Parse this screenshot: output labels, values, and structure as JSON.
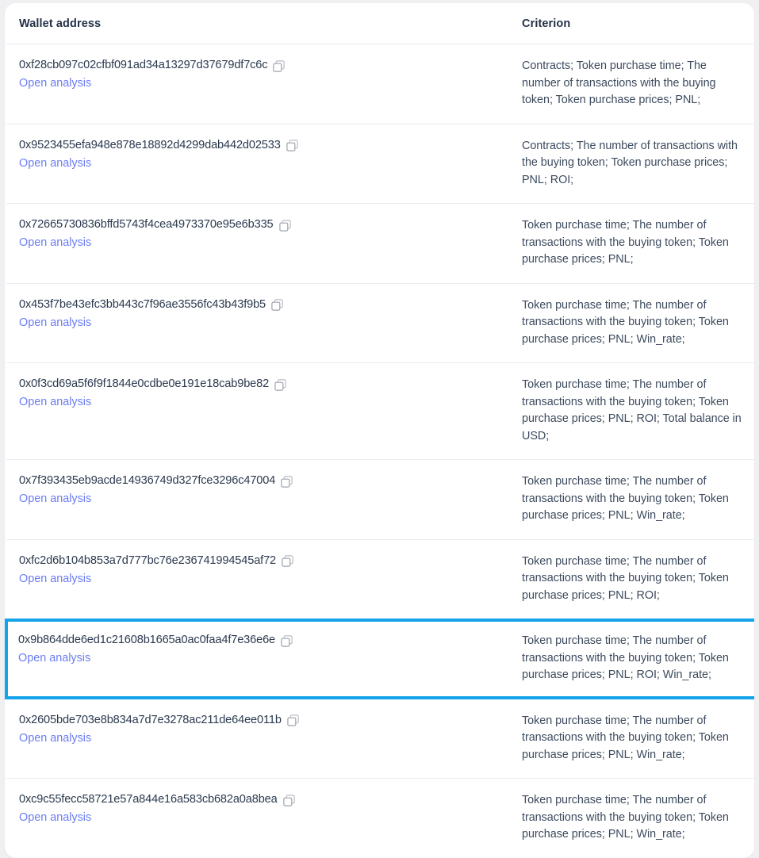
{
  "table": {
    "columns": [
      {
        "key": "wallet",
        "label": "Wallet address"
      },
      {
        "key": "criterion",
        "label": "Criterion"
      }
    ],
    "link_label": "Open analysis",
    "copy_icon": "copy-icon",
    "highlight_color": "#13a3e8",
    "link_color": "#6b7df3",
    "rows": [
      {
        "address": "0xf28cb097c02cfbf091ad34a13297d37679df7c6c",
        "link": "Open analysis",
        "criterion": "Contracts; Token purchase time; The number of transactions with the buying token; Token purchase prices; PNL;",
        "highlighted": false
      },
      {
        "address": "0x9523455efa948e878e18892d4299dab442d02533",
        "link": "Open analysis",
        "criterion": "Contracts; The number of transactions with the buying token; Token purchase prices; PNL; ROI;",
        "highlighted": false
      },
      {
        "address": "0x72665730836bffd5743f4cea4973370e95e6b335",
        "link": "Open analysis",
        "criterion": "Token purchase time; The number of transactions with the buying token; Token purchase prices; PNL;",
        "highlighted": false
      },
      {
        "address": "0x453f7be43efc3bb443c7f96ae3556fc43b43f9b5",
        "link": "Open analysis",
        "criterion": "Token purchase time; The number of transactions with the buying token; Token purchase prices; PNL; Win_rate;",
        "highlighted": false
      },
      {
        "address": "0x0f3cd69a5f6f9f1844e0cdbe0e191e18cab9be82",
        "link": "Open analysis",
        "criterion": "Token purchase time; The number of transactions with the buying token; Token purchase prices; PNL; ROI; Total balance in USD;",
        "highlighted": false
      },
      {
        "address": "0x7f393435eb9acde14936749d327fce3296c47004",
        "link": "Open analysis",
        "criterion": "Token purchase time; The number of transactions with the buying token; Token purchase prices; PNL; Win_rate;",
        "highlighted": false
      },
      {
        "address": "0xfc2d6b104b853a7d777bc76e236741994545af72",
        "link": "Open analysis",
        "criterion": "Token purchase time; The number of transactions with the buying token; Token purchase prices; PNL; ROI;",
        "highlighted": false
      },
      {
        "address": "0x9b864dde6ed1c21608b1665a0ac0faa4f7e36e6e",
        "link": "Open analysis",
        "criterion": "Token purchase time; The number of transactions with the buying token; Token purchase prices; PNL; ROI; Win_rate;",
        "highlighted": true
      },
      {
        "address": "0x2605bde703e8b834a7d7e3278ac211de64ee011b",
        "link": "Open analysis",
        "criterion": "Token purchase time; The number of transactions with the buying token; Token purchase prices; PNL; Win_rate;",
        "highlighted": false
      },
      {
        "address": "0xc9c55fecc58721e57a844e16a583cb682a0a8bea",
        "link": "Open analysis",
        "criterion": "Token purchase time; The number of transactions with the buying token; Token purchase prices; PNL; Win_rate;",
        "highlighted": false
      }
    ]
  }
}
